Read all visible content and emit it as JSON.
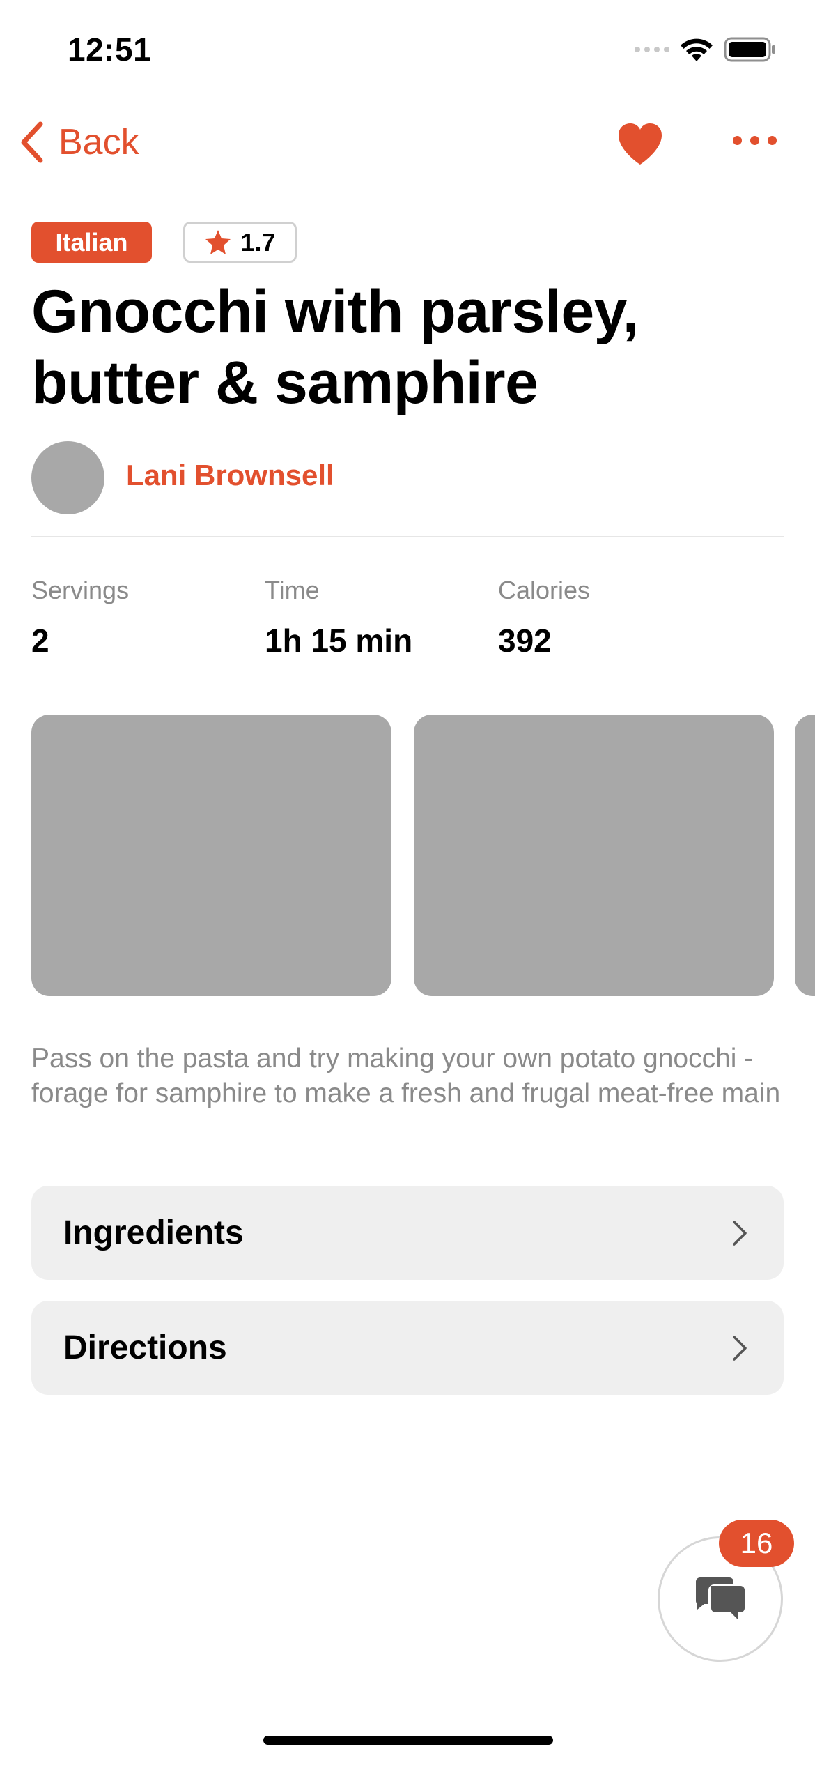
{
  "status_bar": {
    "time": "12:51"
  },
  "nav": {
    "back_label": "Back",
    "icons": {
      "back": "chevron-left-icon",
      "favorite": "heart-icon",
      "more": "ellipsis-icon"
    }
  },
  "colors": {
    "accent": "#e2502e",
    "placeholder": "#a8a8a8",
    "row_bg": "#efefef",
    "muted_text": "#8a8a8a"
  },
  "recipe": {
    "cuisine_tag": "Italian",
    "rating": "1.7",
    "title": "Gnocchi with parsley, butter & samphire",
    "author": "Lani Brownsell",
    "stats": [
      {
        "label": "Servings",
        "value": "2"
      },
      {
        "label": "Time",
        "value": "1h 15 min"
      },
      {
        "label": "Calories",
        "value": "392"
      }
    ],
    "description": "Pass on the pasta and try making your own potato gnocchi - forage for samphire to make a fresh and frugal meat-free main",
    "sections": [
      {
        "label": "Ingredients"
      },
      {
        "label": "Directions"
      }
    ]
  },
  "chat": {
    "badge_count": "16",
    "icon": "chat-bubbles-icon"
  }
}
